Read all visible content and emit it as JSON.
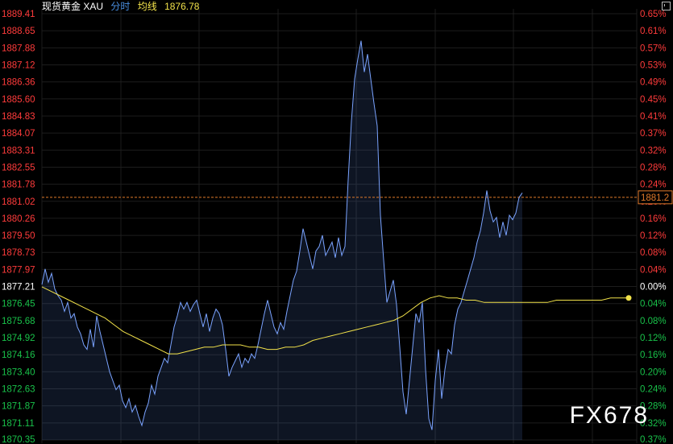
{
  "header": {
    "title": "现货黄金 XAU",
    "tab": "分时",
    "avg_label": "均线",
    "avg_value": "1876.78"
  },
  "watermark": "FX678",
  "current_price_label": "1881.2",
  "colors": {
    "up": "#ff3b3b",
    "down": "#19c24a",
    "neutral": "#ffffff",
    "price_line": "#7aa3ff",
    "avg_line": "#f2e24a",
    "reference_line": "#e07a2b",
    "grid": "#1d1d1d",
    "background": "#000000"
  },
  "chart_data": {
    "type": "line",
    "ylim": [
      1870.35,
      1889.41
    ],
    "base_price": 1877.21,
    "current_price": 1881.2,
    "y_ticks_left": [
      "1889.41",
      "1888.65",
      "1887.88",
      "1887.12",
      "1886.36",
      "1885.60",
      "1884.83",
      "1884.07",
      "1883.31",
      "1882.55",
      "1881.78",
      "1881.02",
      "1880.26",
      "1879.50",
      "1878.73",
      "1877.97",
      "1877.21",
      "1876.45",
      "1875.68",
      "1874.92",
      "1874.16",
      "1873.40",
      "1872.63",
      "1871.87",
      "1871.11",
      "1870.35"
    ],
    "y_ticks_right": [
      "0.65%",
      "0.61%",
      "0.57%",
      "0.53%",
      "0.49%",
      "0.45%",
      "0.41%",
      "0.37%",
      "0.32%",
      "0.28%",
      "0.24%",
      "0.20%",
      "0.16%",
      "0.12%",
      "0.08%",
      "0.04%",
      "0.00%",
      "0.04%",
      "0.08%",
      "0.12%",
      "0.16%",
      "0.20%",
      "0.24%",
      "0.28%",
      "0.32%",
      "0.37%"
    ],
    "x": [
      0,
      2,
      4,
      6,
      8,
      10,
      12,
      14,
      16,
      18,
      20,
      22,
      24,
      26,
      28,
      30,
      32,
      34,
      36,
      38,
      40,
      42,
      44,
      46,
      48,
      50,
      52,
      54,
      56,
      58,
      60,
      62,
      64,
      66,
      68,
      70,
      72,
      74,
      76,
      78,
      80,
      82,
      84,
      86,
      88,
      90,
      92,
      94,
      96,
      98,
      100,
      102,
      104,
      106,
      108,
      110,
      112,
      114,
      116,
      118,
      120,
      122,
      124,
      126,
      128,
      130,
      132,
      134,
      136,
      138,
      140,
      142,
      144,
      146,
      148,
      150,
      152,
      154,
      156,
      158,
      160,
      162,
      164,
      166,
      168,
      170,
      172,
      174,
      176,
      178,
      180,
      182,
      184,
      186,
      188,
      190,
      192,
      194,
      196,
      198,
      200,
      202,
      204,
      206,
      208,
      210,
      212,
      214,
      216,
      218,
      220,
      222,
      224,
      226,
      228,
      230,
      232,
      234,
      236,
      238,
      240,
      242,
      244,
      246,
      248,
      250,
      252,
      254,
      256,
      258,
      260,
      262,
      264,
      266,
      268,
      270,
      272,
      274,
      276,
      278,
      280,
      282,
      284,
      286,
      288,
      290,
      292,
      294,
      296,
      298,
      300,
      302,
      304,
      306,
      308,
      310,
      312,
      314,
      316,
      318,
      320,
      322,
      324,
      326,
      328,
      330,
      332,
      334,
      336,
      338,
      340,
      342,
      344,
      346,
      348,
      350,
      352,
      354,
      356,
      358,
      360,
      362,
      364,
      366,
      368,
      370
    ],
    "series": [
      {
        "values": [
          1877.3,
          1878.0,
          1877.4,
          1877.8,
          1877.1,
          1876.8,
          1876.6,
          1876.1,
          1876.5,
          1875.8,
          1876.0,
          1875.4,
          1875.1,
          1874.6,
          1874.4,
          1875.3,
          1874.5,
          1875.9,
          1875.2,
          1874.6,
          1874.0,
          1873.4,
          1873.0,
          1872.6,
          1872.8,
          1872.1,
          1871.8,
          1872.2,
          1871.6,
          1871.9,
          1871.4,
          1871.0,
          1871.6,
          1872.0,
          1872.8,
          1872.4,
          1873.2,
          1873.6,
          1874.0,
          1873.8,
          1874.6,
          1875.4,
          1875.9,
          1876.5,
          1876.2,
          1876.5,
          1876.1,
          1876.4,
          1876.6,
          1876.0,
          1875.4,
          1876.0,
          1875.2,
          1875.8,
          1876.2,
          1876.0,
          1875.5,
          1874.4,
          1873.2,
          1873.6,
          1873.9,
          1874.2,
          1873.6,
          1874.0,
          1873.8,
          1874.2,
          1874.0,
          1874.6,
          1875.3,
          1876.0,
          1876.6,
          1876.0,
          1875.4,
          1875.1,
          1875.6,
          1875.3,
          1876.1,
          1876.8,
          1877.5,
          1877.9,
          1878.8,
          1879.8,
          1879.2,
          1878.6,
          1878.0,
          1878.8,
          1879.0,
          1879.5,
          1878.6,
          1878.9,
          1879.2,
          1878.5,
          1879.4,
          1878.6,
          1879.0,
          1882.0,
          1884.6,
          1886.5,
          1887.4,
          1888.2,
          1886.8,
          1887.6,
          1886.5,
          1885.4,
          1884.4,
          1880.4,
          1878.4,
          1876.5,
          1877.0,
          1877.5,
          1876.4,
          1874.5,
          1872.5,
          1871.5,
          1873.0,
          1874.5,
          1876.0,
          1875.6,
          1876.5,
          1873.5,
          1871.3,
          1870.8,
          1873.0,
          1874.4,
          1872.2,
          1873.5,
          1874.4,
          1874.2,
          1875.5,
          1876.2,
          1876.5,
          1877.0,
          1877.5,
          1878.0,
          1878.5,
          1879.2,
          1879.7,
          1880.5,
          1881.5,
          1880.6,
          1880.1,
          1880.3,
          1879.4,
          1880.1,
          1879.5,
          1880.4,
          1880.2,
          1880.5,
          1881.2,
          1881.4
        ],
        "color": "#7aa3ff"
      },
      {
        "values": [
          1877.2,
          1877.0,
          1876.8,
          1876.6,
          1876.4,
          1876.2,
          1876.0,
          1875.8,
          1875.5,
          1875.2,
          1875.0,
          1874.8,
          1874.6,
          1874.4,
          1874.2,
          1874.2,
          1874.3,
          1874.4,
          1874.5,
          1874.5,
          1874.6,
          1874.6,
          1874.6,
          1874.5,
          1874.5,
          1874.4,
          1874.4,
          1874.5,
          1874.5,
          1874.6,
          1874.8,
          1874.9,
          1875.0,
          1875.1,
          1875.2,
          1875.3,
          1875.4,
          1875.5,
          1875.6,
          1875.7,
          1875.9,
          1876.2,
          1876.5,
          1876.7,
          1876.8,
          1876.7,
          1876.7,
          1876.6,
          1876.6,
          1876.5,
          1876.5,
          1876.5,
          1876.5,
          1876.5,
          1876.5,
          1876.5,
          1876.5,
          1876.6,
          1876.6,
          1876.6,
          1876.6,
          1876.6,
          1876.6,
          1876.7,
          1876.7,
          1876.7
        ],
        "x_step": 5.6,
        "color": "#f2e24a"
      }
    ]
  }
}
